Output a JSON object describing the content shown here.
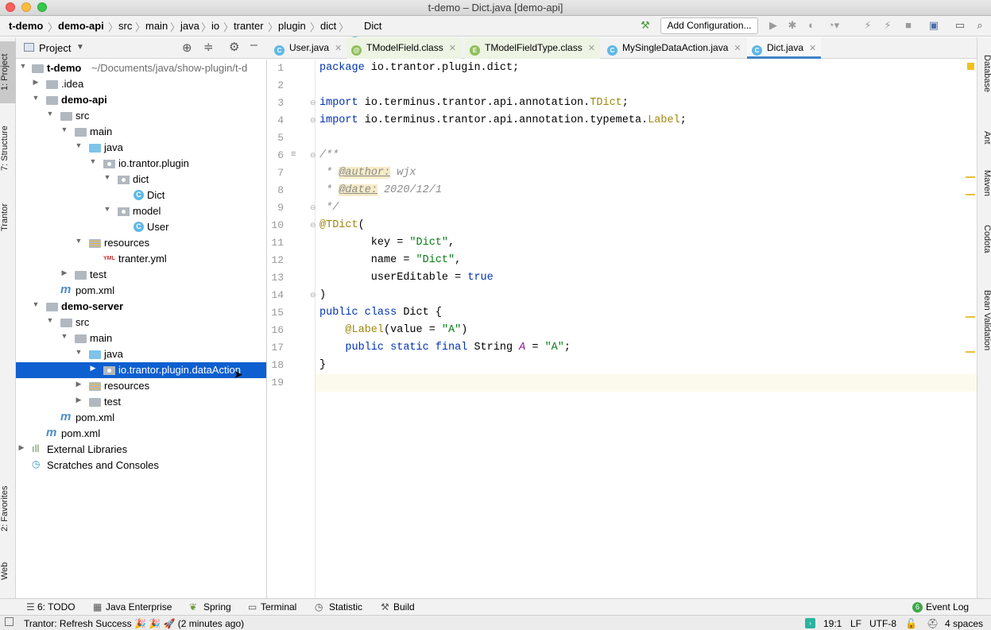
{
  "window": {
    "title": "t-demo – Dict.java [demo-api]"
  },
  "breadcrumb": [
    "t-demo",
    "demo-api",
    "src",
    "main",
    "java",
    "io",
    "tranter",
    "plugin",
    "dict",
    "Dict"
  ],
  "toolbar": {
    "add_configuration": "Add Configuration..."
  },
  "left_stripe": {
    "project": "1: Project",
    "structure": "7: Structure",
    "trantor": "Trantor",
    "favorites": "2: Favorites",
    "web": "Web"
  },
  "project_panel": {
    "title": "Project",
    "tree": [
      {
        "label": "t-demo",
        "extra": "~/Documents/java/show-plugin/t-d"
      },
      {
        "label": ".idea"
      },
      {
        "label": "demo-api"
      },
      {
        "label": "src"
      },
      {
        "label": "main"
      },
      {
        "label": "java"
      },
      {
        "label": "io.trantor.plugin"
      },
      {
        "label": "dict"
      },
      {
        "label": "Dict"
      },
      {
        "label": "model"
      },
      {
        "label": "User"
      },
      {
        "label": "resources"
      },
      {
        "label": "tranter.yml"
      },
      {
        "label": "test"
      },
      {
        "label": "pom.xml"
      },
      {
        "label": "demo-server"
      },
      {
        "label": "src"
      },
      {
        "label": "main"
      },
      {
        "label": "java"
      },
      {
        "label": "io.trantor.plugin.dataAction"
      },
      {
        "label": "resources"
      },
      {
        "label": "test"
      },
      {
        "label": "pom.xml"
      },
      {
        "label": "pom.xml"
      },
      {
        "label": "External Libraries"
      },
      {
        "label": "Scratches and Consoles"
      }
    ]
  },
  "editor_tabs": [
    "User.java",
    "TModelField.class",
    "TModelFieldType.class",
    "MySingleDataAction.java",
    "Dict.java"
  ],
  "code": {
    "line_numbers": [
      "1",
      "2",
      "3",
      "4",
      "5",
      "6",
      "7",
      "8",
      "9",
      "10",
      "11",
      "12",
      "13",
      "14",
      "15",
      "16",
      "17",
      "18",
      "19"
    ],
    "tokens": {
      "package": "package",
      "package_name": "io.trantor.plugin.dict;",
      "import": "import",
      "import1_pre": "io.terminus.trantor.api.annotation.",
      "import1_cls": "TDict",
      "import2_pre": "io.terminus.trantor.api.annotation.typemeta.",
      "import2_cls": "Label",
      "semi": ";",
      "doc_open": "/**",
      "doc_star": " * ",
      "author_tag": "@author:",
      "author_val": " wjx",
      "date_tag": "@date:",
      "date_val": " 2020/12/1",
      "doc_close": " */",
      "ann_tdict": "@TDict",
      "paren_open": "(",
      "key_pre": "        key = ",
      "key_val": "\"Dict\"",
      "name_pre": "        name = ",
      "name_val": "\"Dict\"",
      "comma": ",",
      "editable_pre": "        userEditable = ",
      "editable_val": "true",
      "paren_close": ")",
      "public": "public",
      "class": "class",
      "class_rest": " Dict {",
      "ann_label": "    @Label",
      "label_args_pre": "(value = ",
      "label_val": "\"A\"",
      "label_args_post": ")",
      "field_kw": "    public static final",
      "field_type": " String ",
      "field_name": "A",
      "field_eq": " = ",
      "field_val": "\"A\"",
      "brace_close": "}"
    }
  },
  "right_stripe": {
    "database": "Database",
    "ant": "Ant",
    "maven": "Maven",
    "codota": "Codota",
    "bean_validation": "Bean Validation"
  },
  "bottom_tabs": [
    "6: TODO",
    "Java Enterprise",
    "Spring",
    "Terminal",
    "Statistic",
    "Build"
  ],
  "event_log": {
    "count": "6",
    "label": "Event Log"
  },
  "status": {
    "message": "Trantor: Refresh Success 🎉 🎉 🚀 (2 minutes ago)",
    "position": "19:1",
    "line_sep": "LF",
    "encoding": "UTF-8",
    "indent": "4 spaces"
  },
  "colors": {
    "selection": "#0e5fd0",
    "keyword": "#0033b3",
    "string": "#067d17",
    "annotation": "#9e880d"
  }
}
